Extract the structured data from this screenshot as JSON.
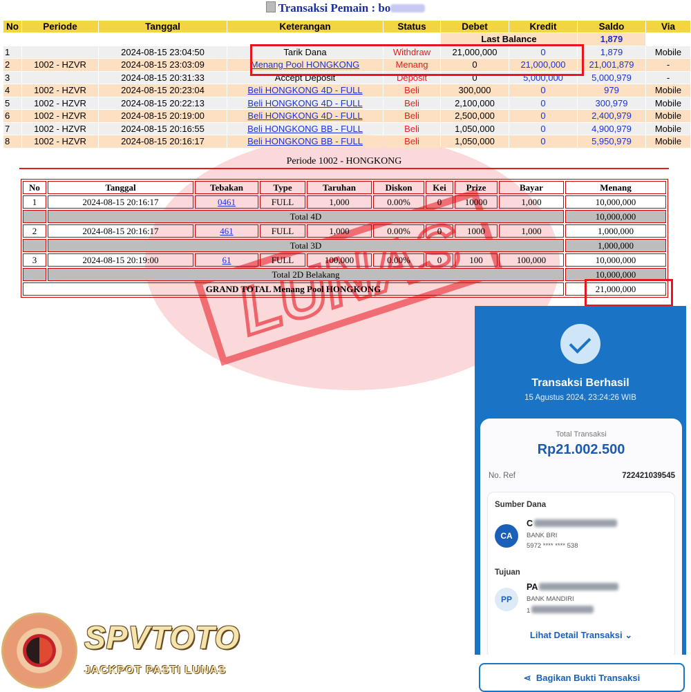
{
  "header": {
    "title": "Transaksi  Pemain : bo"
  },
  "transactions": {
    "columns": [
      "No",
      "Periode",
      "Tanggal",
      "Keterangan",
      "Status",
      "Debet",
      "Kredit",
      "Saldo",
      "Via"
    ],
    "last_balance_label": "Last Balance",
    "last_balance_value": "1,879",
    "rows": [
      {
        "no": "1",
        "periode": "",
        "tanggal": "2024-08-15 23:04:50",
        "keterangan": "Tarik Dana",
        "status": "Withdraw",
        "debet": "21,000,000",
        "kredit": "0",
        "saldo": "1,879",
        "via": "Mobile"
      },
      {
        "no": "2",
        "periode": "1002 - HZVR",
        "tanggal": "2024-08-15 23:03:09",
        "keterangan": "Menang Pool HONGKONG",
        "status": "Menang",
        "debet": "0",
        "kredit": "21,000,000",
        "saldo": "21,001,879",
        "via": "-"
      },
      {
        "no": "3",
        "periode": "",
        "tanggal": "2024-08-15 20:31:33",
        "keterangan": "Accept Deposit",
        "status": "Deposit",
        "debet": "0",
        "kredit": "5,000,000",
        "saldo": "5,000,979",
        "via": "-"
      },
      {
        "no": "4",
        "periode": "1002 - HZVR",
        "tanggal": "2024-08-15 20:23:04",
        "keterangan": "Beli HONGKONG 4D - FULL",
        "status": "Beli",
        "debet": "300,000",
        "kredit": "0",
        "saldo": "979",
        "via": "Mobile"
      },
      {
        "no": "5",
        "periode": "1002 - HZVR",
        "tanggal": "2024-08-15 20:22:13",
        "keterangan": "Beli HONGKONG 4D - FULL",
        "status": "Beli",
        "debet": "2,100,000",
        "kredit": "0",
        "saldo": "300,979",
        "via": "Mobile"
      },
      {
        "no": "6",
        "periode": "1002 - HZVR",
        "tanggal": "2024-08-15 20:19:00",
        "keterangan": "Beli HONGKONG 4D - FULL",
        "status": "Beli",
        "debet": "2,500,000",
        "kredit": "0",
        "saldo": "2,400,979",
        "via": "Mobile"
      },
      {
        "no": "7",
        "periode": "1002 - HZVR",
        "tanggal": "2024-08-15 20:16:55",
        "keterangan": "Beli HONGKONG BB - FULL",
        "status": "Beli",
        "debet": "1,050,000",
        "kredit": "0",
        "saldo": "4,900,979",
        "via": "Mobile"
      },
      {
        "no": "8",
        "periode": "1002 - HZVR",
        "tanggal": "2024-08-15 20:16:17",
        "keterangan": "Beli HONGKONG BB - FULL",
        "status": "Beli",
        "debet": "1,050,000",
        "kredit": "0",
        "saldo": "5,950,979",
        "via": "Mobile"
      }
    ]
  },
  "detail": {
    "periode_title": "Periode 1002 - HONGKONG",
    "columns": [
      "No",
      "Tanggal",
      "Tebakan",
      "Type",
      "Taruhan",
      "Diskon",
      "Kei",
      "Prize",
      "Bayar",
      "Menang"
    ],
    "rows": [
      {
        "no": "1",
        "tanggal": "2024-08-15 20:16:17",
        "tebakan": "0461",
        "type": "FULL",
        "taruhan": "1,000",
        "diskon": "0.00%",
        "kei": "0",
        "prize": "10000",
        "bayar": "1,000",
        "menang": "10,000,000"
      },
      {
        "no": "2",
        "tanggal": "2024-08-15 20:16:17",
        "tebakan": "461",
        "type": "FULL",
        "taruhan": "1,000",
        "diskon": "0.00%",
        "kei": "0",
        "prize": "1000",
        "bayar": "1,000",
        "menang": "1,000,000"
      },
      {
        "no": "3",
        "tanggal": "2024-08-15 20:19:00",
        "tebakan": "61",
        "type": "FULL",
        "taruhan": "100,000",
        "diskon": "0.00%",
        "kei": "0",
        "prize": "100",
        "bayar": "100,000",
        "menang": "10,000,000"
      }
    ],
    "totals": [
      {
        "label": "Total 4D",
        "value": "10,000,000"
      },
      {
        "label": "Total 3D",
        "value": "1,000,000"
      },
      {
        "label": "Total 2D Belakang",
        "value": "10,000,000"
      }
    ],
    "grand_total_label": "GRAND TOTAL  Menang Pool HONGKONG",
    "grand_total_value": "21,000,000"
  },
  "watermark": {
    "text": "LUNAS",
    "color": "#e8141e"
  },
  "receipt": {
    "title": "Transaksi Berhasil",
    "datetime": "15 Agustus 2024, 23:24:26 WIB",
    "total_label": "Total Transaksi",
    "total_value": "Rp21.002.500",
    "ref_label": "No. Ref",
    "ref_value": "722421039545",
    "source_label": "Sumber Dana",
    "source_initials": "CA",
    "source_name": "C",
    "source_bank": "BANK BRI",
    "source_account": "5972 **** **** 538",
    "dest_label": "Tujuan",
    "dest_initials": "PP",
    "dest_name": "PA",
    "dest_bank": "BANK MANDIRI",
    "dest_account": "1",
    "detail_link": "Lihat Detail Transaksi",
    "share_button": "Bagikan Bukti Transaksi",
    "accent_color": "#1a73c5"
  },
  "logo": {
    "brand": "SPVTOTO",
    "tagline": "JACKPOT PASTI LUNAS"
  }
}
